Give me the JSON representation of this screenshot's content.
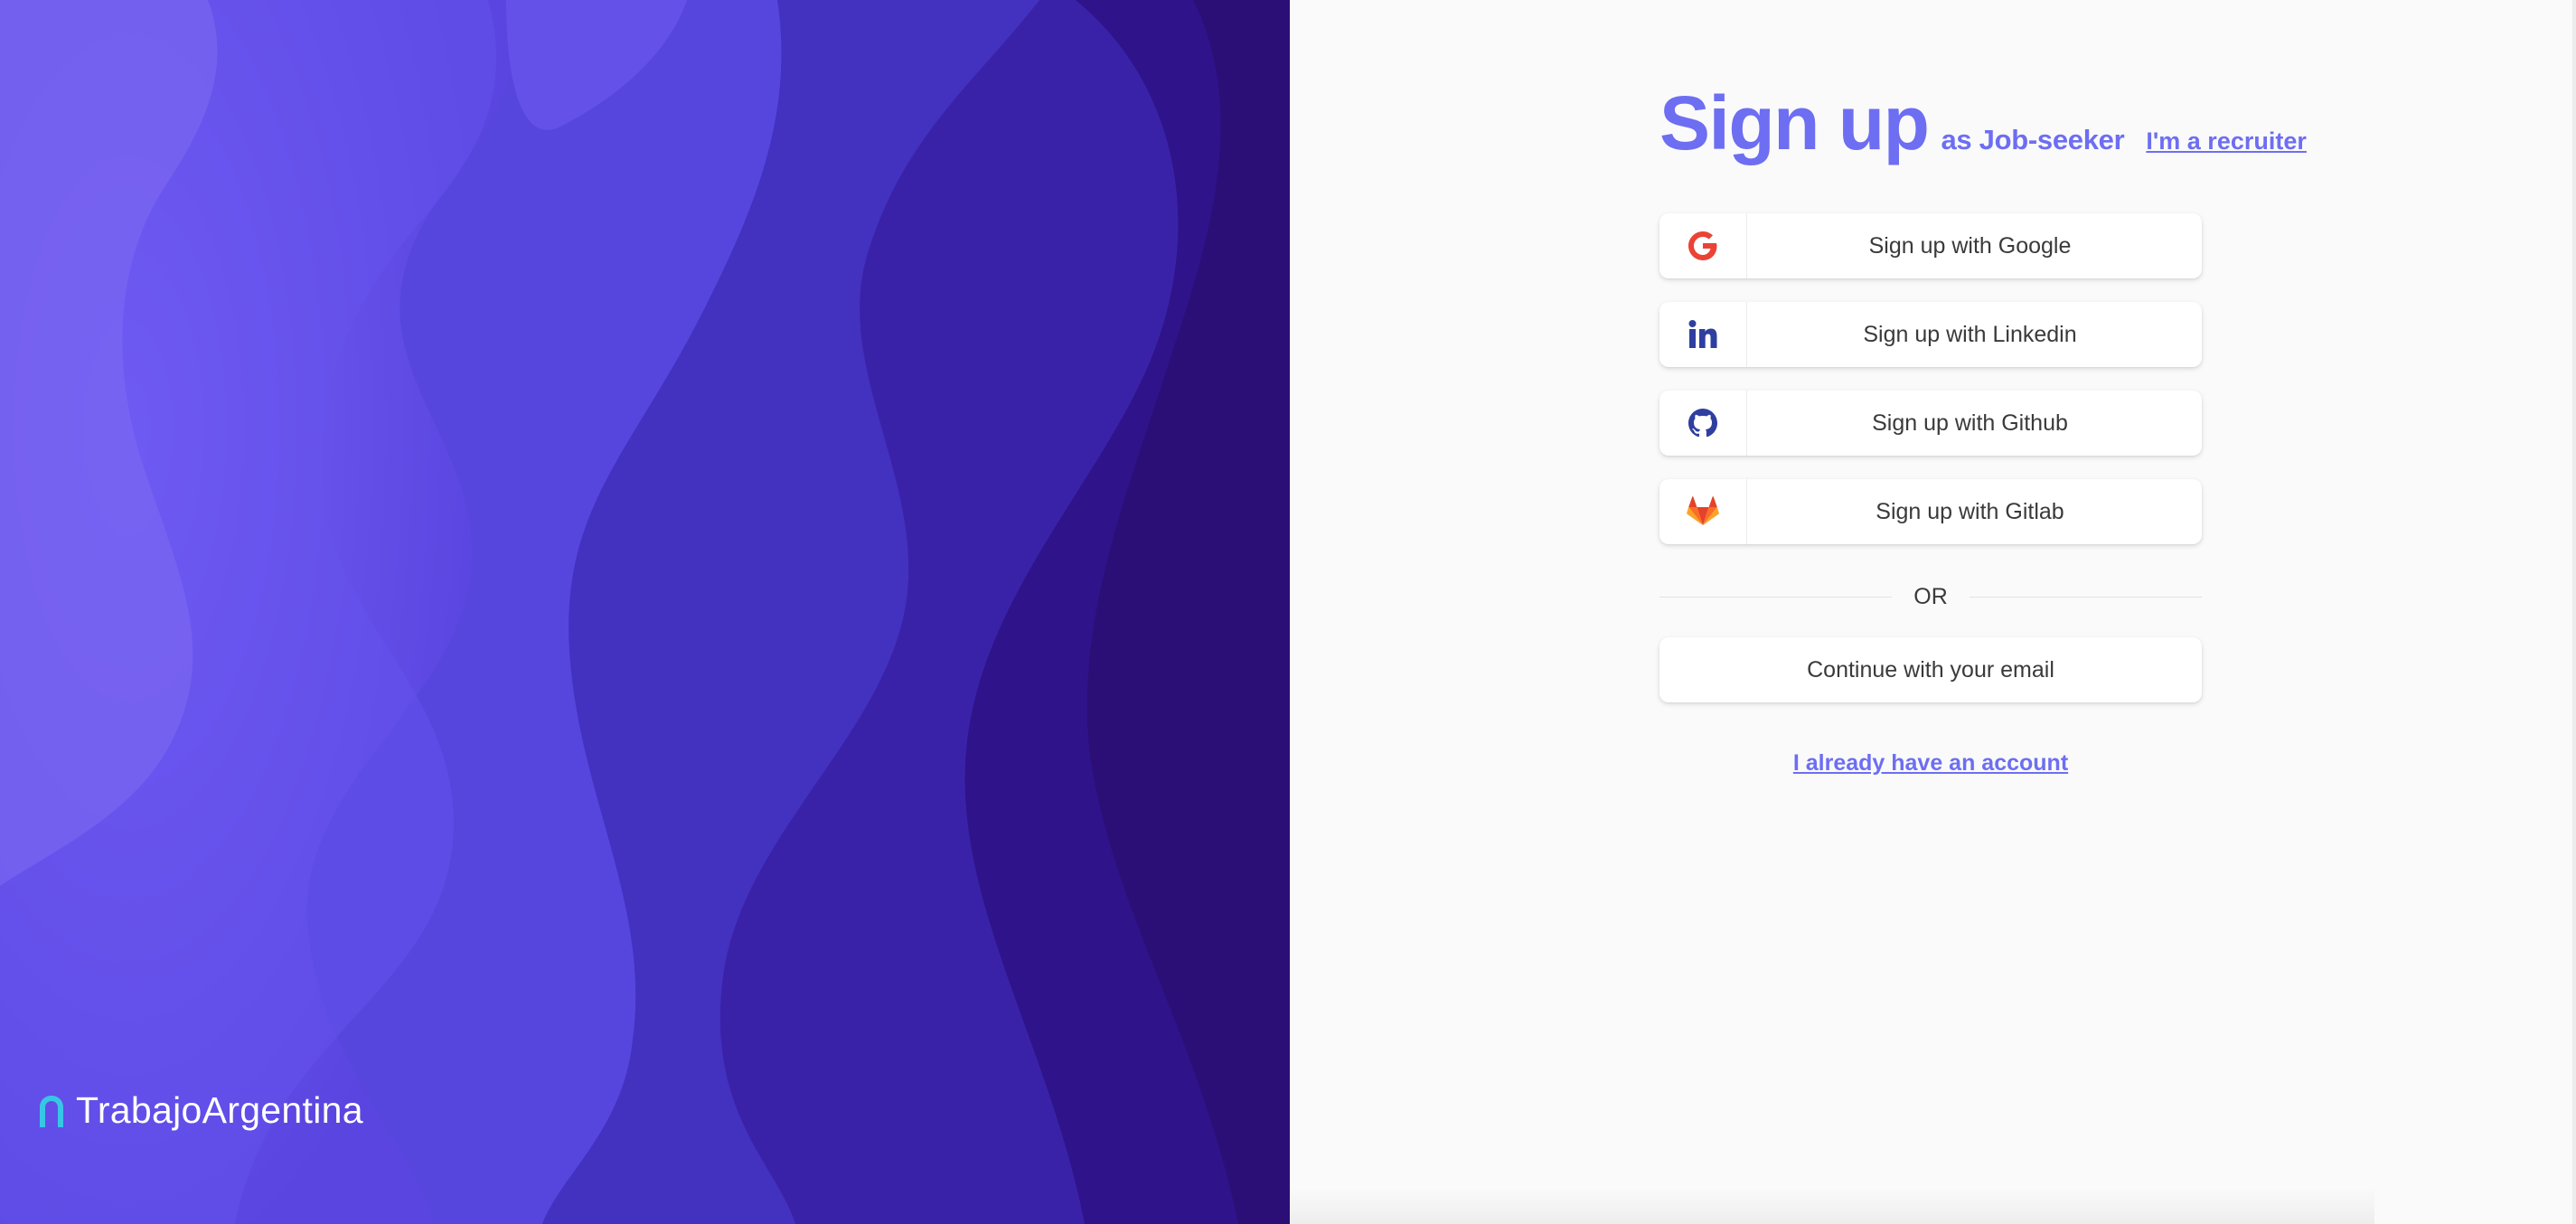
{
  "brand": {
    "name": "TrabajoArgentina",
    "logo_icon": "arch-logo-icon",
    "logo_color": "#38c6e6"
  },
  "heading": {
    "title": "Sign up",
    "subtitle": "as Job-seeker",
    "recruiter_link": "I'm a recruiter",
    "accent_color": "#6d6ef2"
  },
  "oauth": [
    {
      "label": "Sign up with Google",
      "icon": "google-icon",
      "icon_color": "#ea4335"
    },
    {
      "label": "Sign up with Linkedin",
      "icon": "linkedin-icon",
      "icon_color": "#2f3fa0"
    },
    {
      "label": "Sign up with Github",
      "icon": "github-icon",
      "icon_color": "#2f3fa0"
    },
    {
      "label": "Sign up with Gitlab",
      "icon": "gitlab-icon",
      "icon_color": "#e24329"
    }
  ],
  "divider": {
    "text": "OR"
  },
  "email_button": {
    "label": "Continue with your email"
  },
  "login_link": {
    "label": "I already have an account"
  },
  "background": {
    "wave_colors": [
      "#6f58f4",
      "#5c49e6",
      "#4a3cd1",
      "#3a2bb4",
      "#2c1991",
      "#200a66"
    ]
  }
}
